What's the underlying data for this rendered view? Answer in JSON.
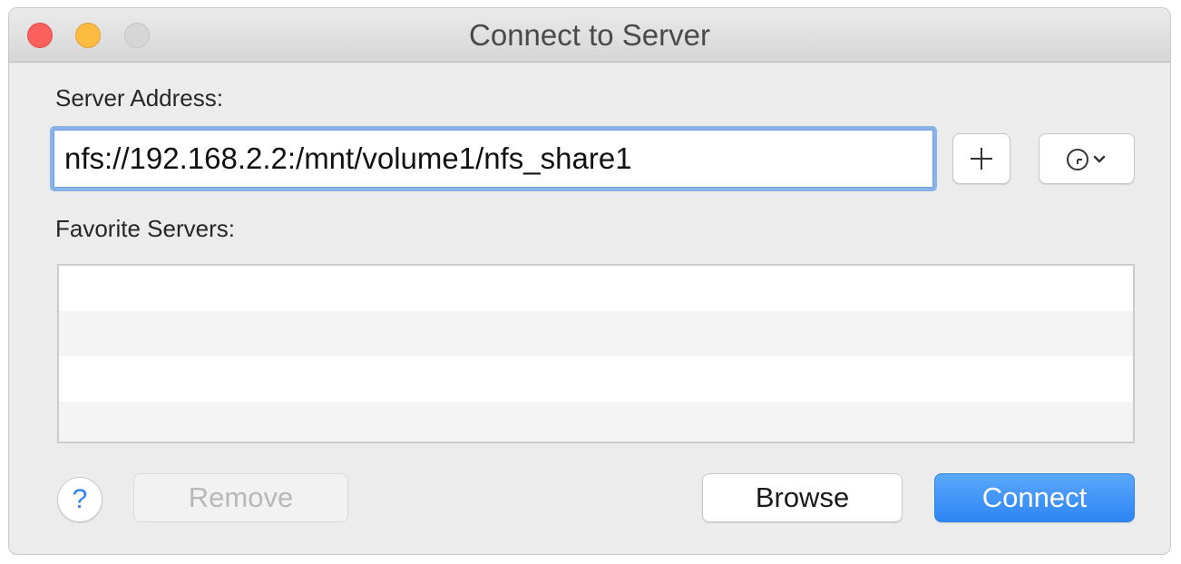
{
  "window": {
    "title": "Connect to Server"
  },
  "server_address": {
    "label": "Server Address:",
    "value": "nfs://192.168.2.2:/mnt/volume1/nfs_share1",
    "add_icon": "plus-icon",
    "history_icon": "clock-icon"
  },
  "favorites": {
    "label": "Favorite Servers:",
    "items": []
  },
  "footer": {
    "help_label": "?",
    "remove_label": "Remove",
    "browse_label": "Browse",
    "connect_label": "Connect"
  },
  "colors": {
    "close": "#fc605c",
    "minimize": "#fdbc40",
    "zoom": "#d6d6d6",
    "accent": "#2e86f3",
    "focus_ring": "#8ab3e8"
  }
}
